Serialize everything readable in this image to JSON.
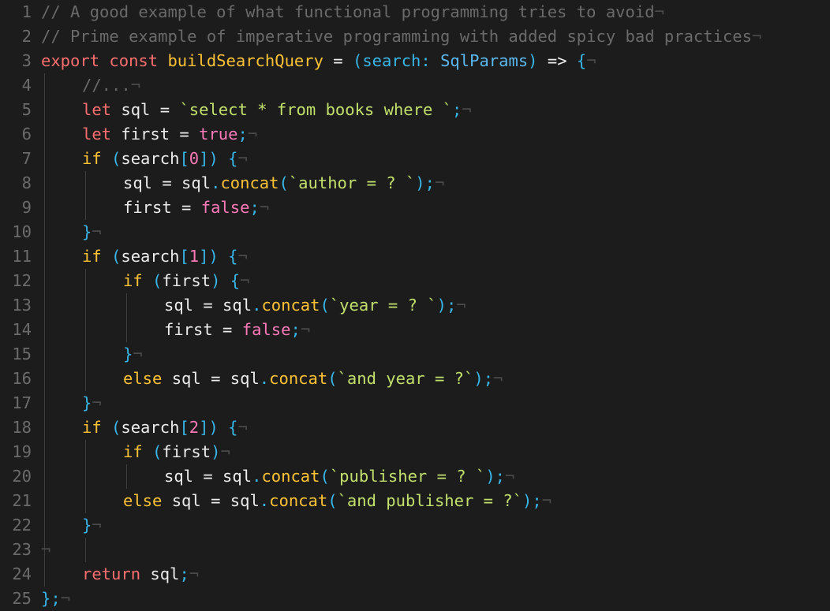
{
  "editor": {
    "eol_marker": "¬",
    "lines": [
      {
        "n": "1",
        "indent": 0,
        "tokens": [
          [
            "// A good example of what functional programming tries to avoid",
            "com"
          ]
        ]
      },
      {
        "n": "2",
        "indent": 0,
        "tokens": [
          [
            "// Prime example of imperative programming with added spicy bad practices",
            "com"
          ]
        ]
      },
      {
        "n": "3",
        "indent": 0,
        "tokens": [
          [
            "export",
            "kw"
          ],
          [
            " ",
            "op"
          ],
          [
            "const",
            "kw"
          ],
          [
            " ",
            "op"
          ],
          [
            "buildSearchQuery",
            "fn"
          ],
          [
            " = ",
            "op"
          ],
          [
            "(",
            "punc"
          ],
          [
            "search",
            "param"
          ],
          [
            ": ",
            "punc"
          ],
          [
            "SqlParams",
            "type"
          ],
          [
            ")",
            "punc"
          ],
          [
            " => ",
            "op"
          ],
          [
            "{",
            "punc"
          ]
        ]
      },
      {
        "n": "4",
        "indent": 1,
        "tokens": [
          [
            "//...",
            "com"
          ]
        ]
      },
      {
        "n": "5",
        "indent": 1,
        "tokens": [
          [
            "let",
            "kw"
          ],
          [
            " sql = ",
            "id"
          ],
          [
            "`select * from books where `",
            "str"
          ],
          [
            ";",
            "punc"
          ]
        ]
      },
      {
        "n": "6",
        "indent": 1,
        "tokens": [
          [
            "let",
            "kw"
          ],
          [
            " first = ",
            "id"
          ],
          [
            "true",
            "bool"
          ],
          [
            ";",
            "punc"
          ]
        ]
      },
      {
        "n": "7",
        "indent": 1,
        "tokens": [
          [
            "if",
            "kw2"
          ],
          [
            " ",
            "op"
          ],
          [
            "(",
            "punc"
          ],
          [
            "search",
            "id"
          ],
          [
            "[",
            "punc"
          ],
          [
            "0",
            "num"
          ],
          [
            "]",
            "punc"
          ],
          [
            ")",
            "punc"
          ],
          [
            " ",
            "op"
          ],
          [
            "{",
            "punc"
          ]
        ]
      },
      {
        "n": "8",
        "indent": 2,
        "tokens": [
          [
            "sql = sql",
            "id"
          ],
          [
            ".",
            "punc"
          ],
          [
            "concat",
            "fn"
          ],
          [
            "(",
            "punc"
          ],
          [
            "`author = ? `",
            "str"
          ],
          [
            ")",
            "punc"
          ],
          [
            ";",
            "punc"
          ]
        ]
      },
      {
        "n": "9",
        "indent": 2,
        "tokens": [
          [
            "first = ",
            "id"
          ],
          [
            "false",
            "bool"
          ],
          [
            ";",
            "punc"
          ]
        ]
      },
      {
        "n": "10",
        "indent": 1,
        "tokens": [
          [
            "}",
            "punc"
          ]
        ]
      },
      {
        "n": "11",
        "indent": 1,
        "tokens": [
          [
            "if",
            "kw2"
          ],
          [
            " ",
            "op"
          ],
          [
            "(",
            "punc"
          ],
          [
            "search",
            "id"
          ],
          [
            "[",
            "punc"
          ],
          [
            "1",
            "num"
          ],
          [
            "]",
            "punc"
          ],
          [
            ")",
            "punc"
          ],
          [
            " ",
            "op"
          ],
          [
            "{",
            "punc"
          ]
        ]
      },
      {
        "n": "12",
        "indent": 2,
        "tokens": [
          [
            "if",
            "kw2"
          ],
          [
            " ",
            "op"
          ],
          [
            "(",
            "punc"
          ],
          [
            "first",
            "id"
          ],
          [
            ")",
            "punc"
          ],
          [
            " ",
            "op"
          ],
          [
            "{",
            "punc"
          ]
        ]
      },
      {
        "n": "13",
        "indent": 3,
        "tokens": [
          [
            "sql = sql",
            "id"
          ],
          [
            ".",
            "punc"
          ],
          [
            "concat",
            "fn"
          ],
          [
            "(",
            "punc"
          ],
          [
            "`year = ? `",
            "str"
          ],
          [
            ")",
            "punc"
          ],
          [
            ";",
            "punc"
          ]
        ]
      },
      {
        "n": "14",
        "indent": 3,
        "tokens": [
          [
            "first = ",
            "id"
          ],
          [
            "false",
            "bool"
          ],
          [
            ";",
            "punc"
          ]
        ]
      },
      {
        "n": "15",
        "indent": 2,
        "tokens": [
          [
            "}",
            "punc"
          ]
        ]
      },
      {
        "n": "16",
        "indent": 2,
        "tokens": [
          [
            "else",
            "kw2"
          ],
          [
            " sql = sql",
            "id"
          ],
          [
            ".",
            "punc"
          ],
          [
            "concat",
            "fn"
          ],
          [
            "(",
            "punc"
          ],
          [
            "`and year = ?`",
            "str"
          ],
          [
            ")",
            "punc"
          ],
          [
            ";",
            "punc"
          ]
        ]
      },
      {
        "n": "17",
        "indent": 1,
        "tokens": [
          [
            "}",
            "punc"
          ]
        ]
      },
      {
        "n": "18",
        "indent": 1,
        "tokens": [
          [
            "if",
            "kw2"
          ],
          [
            " ",
            "op"
          ],
          [
            "(",
            "punc"
          ],
          [
            "search",
            "id"
          ],
          [
            "[",
            "punc"
          ],
          [
            "2",
            "num"
          ],
          [
            "]",
            "punc"
          ],
          [
            ")",
            "punc"
          ],
          [
            " ",
            "op"
          ],
          [
            "{",
            "punc"
          ]
        ]
      },
      {
        "n": "19",
        "indent": 2,
        "tokens": [
          [
            "if",
            "kw2"
          ],
          [
            " ",
            "op"
          ],
          [
            "(",
            "punc"
          ],
          [
            "first",
            "id"
          ],
          [
            ")",
            "punc"
          ]
        ]
      },
      {
        "n": "20",
        "indent": 3,
        "tokens": [
          [
            "sql = sql",
            "id"
          ],
          [
            ".",
            "punc"
          ],
          [
            "concat",
            "fn"
          ],
          [
            "(",
            "punc"
          ],
          [
            "`publisher = ? `",
            "str"
          ],
          [
            ")",
            "punc"
          ],
          [
            ";",
            "punc"
          ]
        ]
      },
      {
        "n": "21",
        "indent": 2,
        "tokens": [
          [
            "else",
            "kw2"
          ],
          [
            " sql = sql",
            "id"
          ],
          [
            ".",
            "punc"
          ],
          [
            "concat",
            "fn"
          ],
          [
            "(",
            "punc"
          ],
          [
            "`and publisher = ?`",
            "str"
          ],
          [
            ")",
            "punc"
          ],
          [
            ";",
            "punc"
          ]
        ]
      },
      {
        "n": "22",
        "indent": 1,
        "tokens": [
          [
            "}",
            "punc"
          ]
        ]
      },
      {
        "n": "23",
        "indent": 0,
        "tokens": []
      },
      {
        "n": "24",
        "indent": 1,
        "tokens": [
          [
            "return",
            "kw"
          ],
          [
            " sql",
            "id"
          ],
          [
            ";",
            "punc"
          ]
        ]
      },
      {
        "n": "25",
        "indent": 0,
        "tokens": [
          [
            "}",
            "punc"
          ],
          [
            ";",
            "punc"
          ]
        ]
      }
    ],
    "guides": [
      {
        "level": 1,
        "from": 4,
        "to": 24
      },
      {
        "level": 2,
        "from": 8,
        "to": 9
      },
      {
        "level": 2,
        "from": 12,
        "to": 16
      },
      {
        "level": 3,
        "from": 13,
        "to": 14
      },
      {
        "level": 2,
        "from": 19,
        "to": 21
      },
      {
        "level": 3,
        "from": 20,
        "to": 20
      },
      {
        "level": 2,
        "from": 23,
        "to": 23
      }
    ],
    "colors": {
      "background": "#1c1c1c",
      "keyword": "#ff6e6e",
      "control": "#ffc235",
      "function": "#ffc235",
      "string": "#c2e06b",
      "boolean": "#ff79b8",
      "punctuation": "#38b6e8",
      "type": "#5ab8f0",
      "comment": "#6a6a6a",
      "line_number": "#6b6b6b"
    }
  }
}
